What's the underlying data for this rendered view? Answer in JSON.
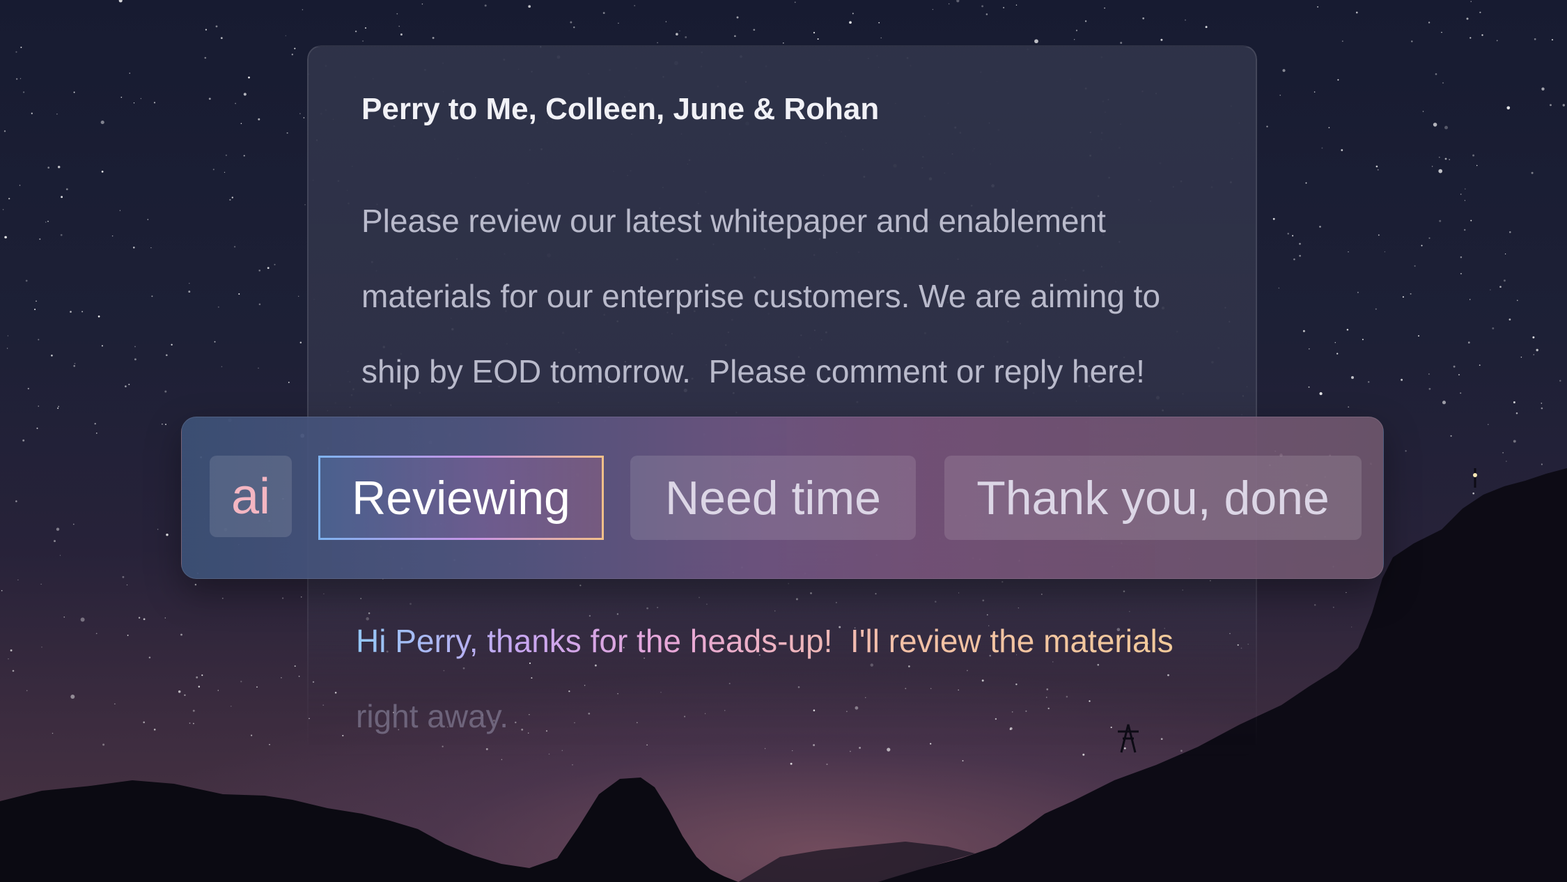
{
  "email": {
    "sender_line": "Perry to Me, Colleen, June & Rohan",
    "body_lines": [
      "Please review our latest whitepaper and enablement",
      "materials for our enterprise customers. We are aiming to",
      "ship by EOD tomorrow.  Please comment or reply here!"
    ]
  },
  "ai_bar": {
    "badge": "ai",
    "options": [
      "Reviewing",
      "Need time",
      "Thank you, done"
    ],
    "selected": "Reviewing"
  },
  "draft_reply": {
    "lines": [
      "Hi Perry, thanks for the heads-up!  I'll review the materials",
      "right away."
    ]
  },
  "colors": {
    "sky_top": "#171b31",
    "sky_horizon": "#4a3443",
    "card": "#30344a",
    "badge_text": "#f4b6c2",
    "gradient_start": "#93c7f6",
    "gradient_end": "#f2cd96"
  }
}
